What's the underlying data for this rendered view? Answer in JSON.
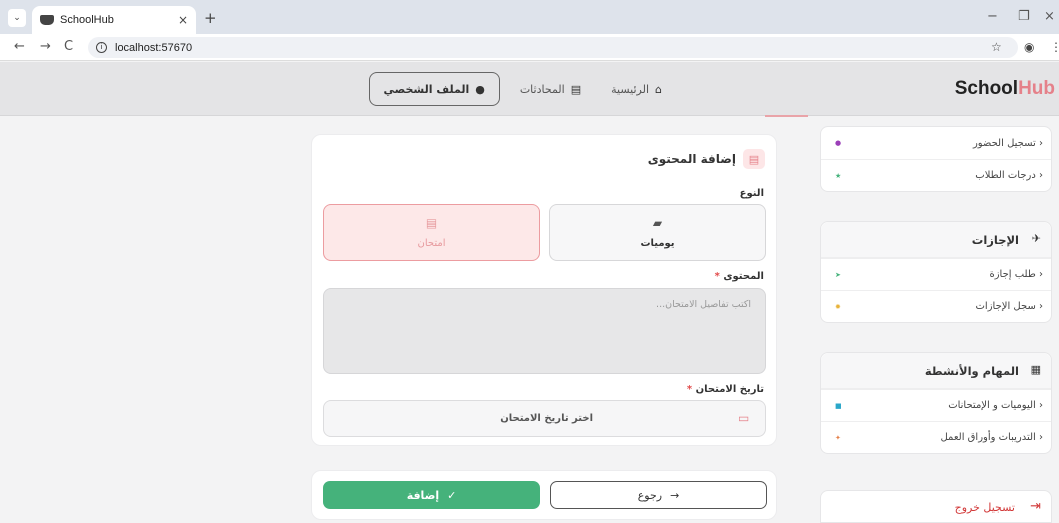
{
  "browser": {
    "tab_title": "SchoolHub",
    "tab_close": "×",
    "new_tab": "+",
    "url": "localhost:57670",
    "back": "←",
    "forward": "→",
    "reload": "C",
    "star": "☆",
    "minimize": "−",
    "restore": "❐",
    "close": "×"
  },
  "header": {
    "brand_part1": "School",
    "brand_part2": "Hub",
    "nav": [
      {
        "label": "الرئيسية",
        "icon": "home-icon"
      },
      {
        "label": "المحادثات",
        "icon": "chat-icon"
      },
      {
        "label": "الملف الشخصي",
        "icon": "user-icon"
      }
    ]
  },
  "sidebar": {
    "group1": {
      "items": [
        {
          "label": "تسجيل الحضور",
          "dot_color": "#9b3fb8"
        },
        {
          "label": "درجات الطلاب",
          "dot_color": "#45b27b"
        }
      ]
    },
    "group2": {
      "title": "الإجازات",
      "items": [
        {
          "label": "طلب إجازة",
          "dot_color": "#45b27b"
        },
        {
          "label": "سجل الإجازات",
          "dot_color": "#e8b33a"
        }
      ]
    },
    "group3": {
      "title": "المهام والأنشطة",
      "items": [
        {
          "label": "اليوميات و الإمتحانات",
          "dot_color": "#2aa7c9"
        },
        {
          "label": "التدريبات وأوراق العمل",
          "dot_color": "#e5814a"
        }
      ]
    },
    "logout": "تسجيل خروج"
  },
  "form": {
    "title": "إضافة المحتوى",
    "type_label": "النوع",
    "types": [
      {
        "label": "يوميات",
        "icon": "tag-icon",
        "selected": false
      },
      {
        "label": "امتحان",
        "icon": "clipboard-icon",
        "selected": true
      }
    ],
    "content_label": "المحتوى",
    "content_placeholder": "اكتب تفاصيل الامتحان...",
    "date_label": "تاريخ الامتحان",
    "date_placeholder": "اختر تاريخ الامتحان",
    "required_mark": "*"
  },
  "actions": {
    "back_label": "رجوع",
    "add_label": "إضافة"
  }
}
